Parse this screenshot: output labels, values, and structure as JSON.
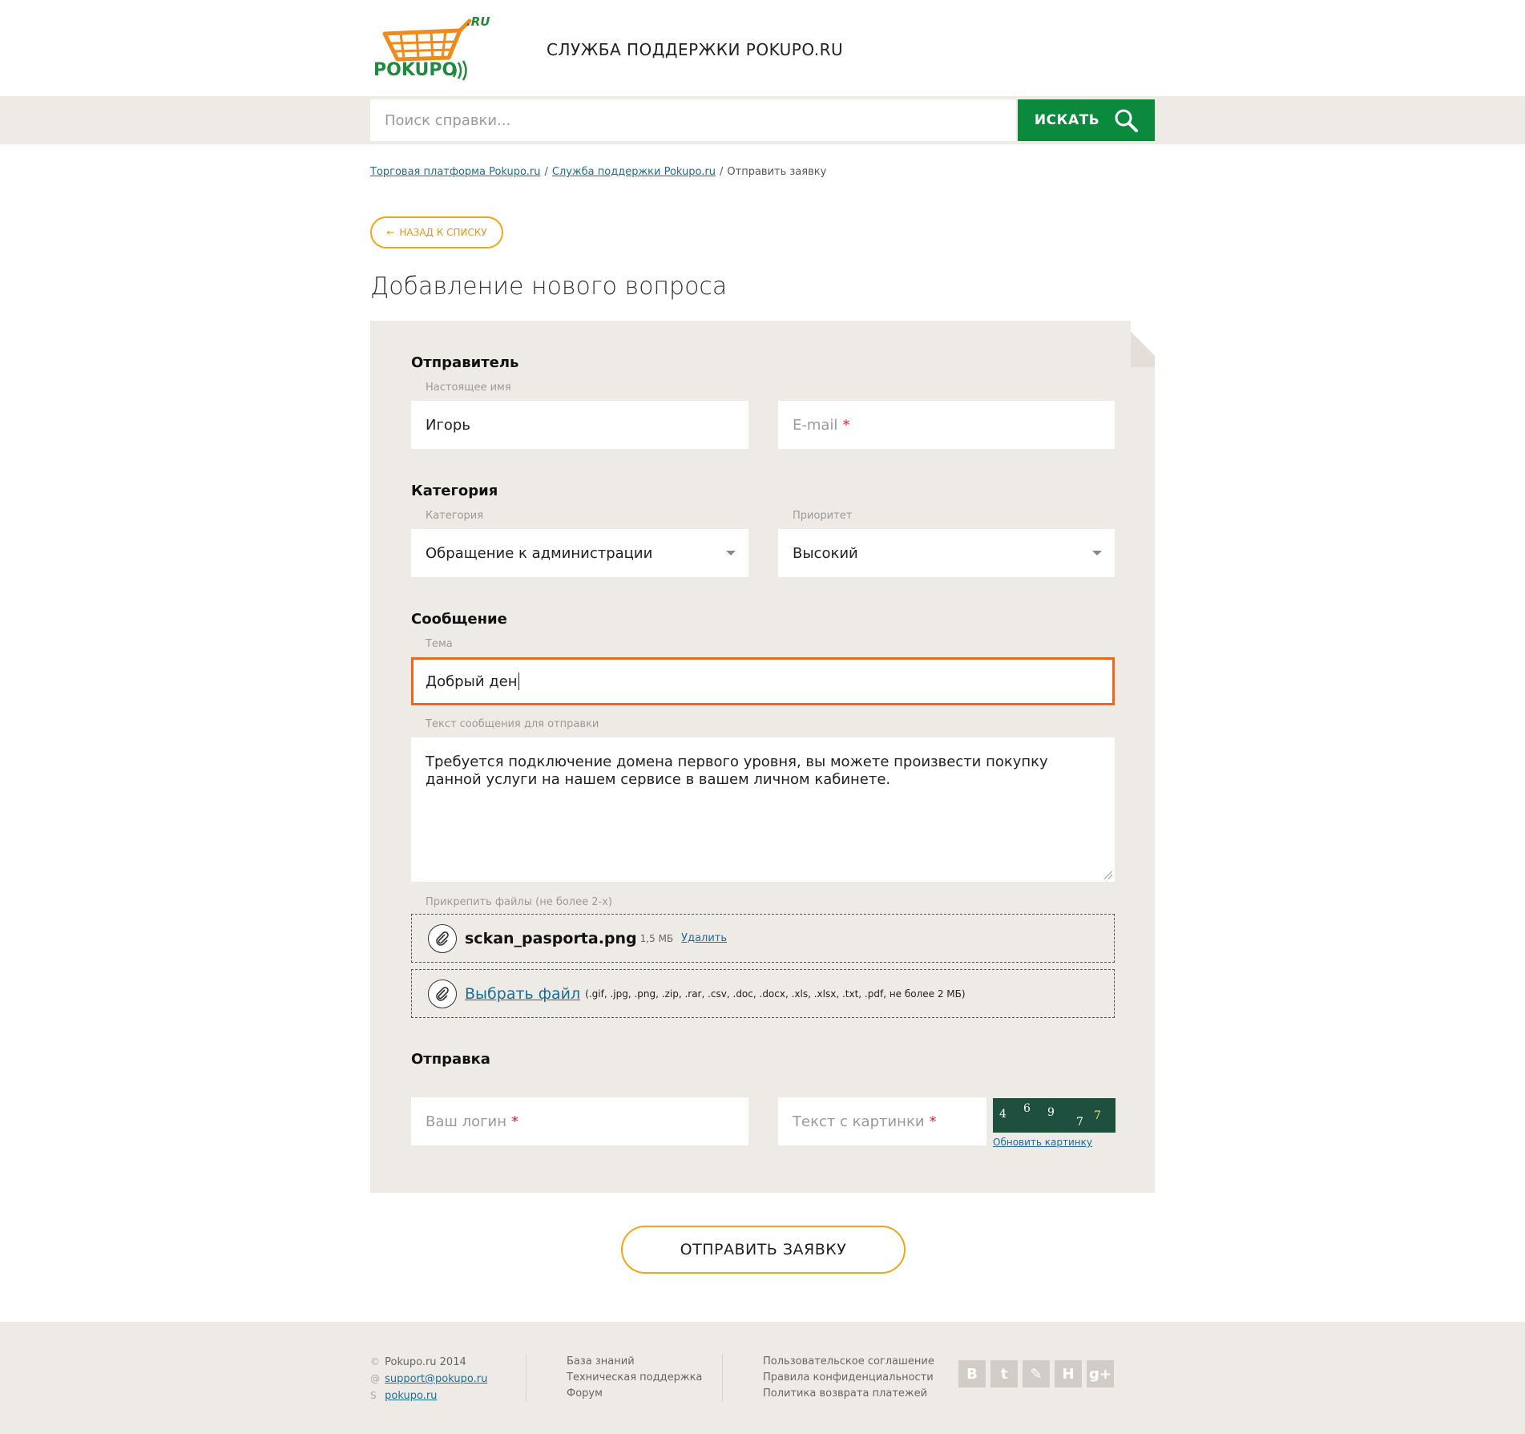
{
  "header": {
    "logo_text": "POKUPO",
    "logo_tld": ".RU",
    "site_title": "СЛУЖБА ПОДДЕРЖКИ POKUPO.RU"
  },
  "search": {
    "placeholder": "Поиск справки...",
    "button_label": "ИСКАТЬ"
  },
  "breadcrumb": {
    "items": [
      "Торговая платформа Pokupo.ru",
      "Служба поддержки Pokupo.ru",
      "Отправить заявку"
    ],
    "separator": "/"
  },
  "back_button": "НАЗАД К СПИСКУ",
  "page_title": "Добавление нового вопроса",
  "form": {
    "sender": {
      "title": "Отправитель",
      "name_label": "Настоящее имя",
      "name_value": "Игорь",
      "email_placeholder": "E-mail",
      "required_mark": "*"
    },
    "category": {
      "title": "Категория",
      "category_label": "Категория",
      "category_value": "Обращение к администрации",
      "priority_label": "Приоритет",
      "priority_value": "Высокий"
    },
    "message": {
      "title": "Сообщение",
      "subject_label": "Тема",
      "subject_value": "Добрый ден",
      "text_label": "Текст сообщения для отправки",
      "text_line1": "Требуется подключение домена первого уровня, вы можете произвести покупку",
      "text_line2": "данной услуги на нашем сервисе в вашем личном кабинете.",
      "attach_label": "Прикрепить файлы (не более 2-х)",
      "file_name": "sckan_pasporta.png",
      "file_size": "1,5 МБ",
      "file_delete": "Удалить",
      "choose_file": "Выбрать файл",
      "file_hint": "(.gif, .jpg, .png, .zip, .rar, .csv, .doc, .docx, .xls, .xlsx, .txt, .pdf, не более 2 МБ)"
    },
    "submit_section": {
      "title": "Отправка",
      "login_placeholder": "Ваш логин",
      "captcha_placeholder": "Текст с картинки",
      "captcha_chars": [
        "4",
        "6",
        "9",
        "7",
        "7"
      ],
      "captcha_refresh": "Обновить картинку"
    },
    "submit_button": "ОТПРАВИТЬ ЗАЯВКУ"
  },
  "footer": {
    "copyright": "Pokupo.ru 2014",
    "email": "support@pokupo.ru",
    "skype": "pokupo.ru",
    "links_col2": [
      "База знаний",
      "Техническая поддержка",
      "Форум"
    ],
    "links_col3": [
      "Пользовательское соглашение",
      "Правила конфиденциальности",
      "Политика возврата платежей"
    ],
    "social": [
      "В",
      "t",
      "✎",
      "H",
      "g+"
    ]
  },
  "colors": {
    "brand_green": "#0b8a3e",
    "accent_orange": "#f0a51b",
    "focus_orange": "#f1651f",
    "panel_bg": "#eeebe6",
    "link_blue": "#1b6d99"
  }
}
